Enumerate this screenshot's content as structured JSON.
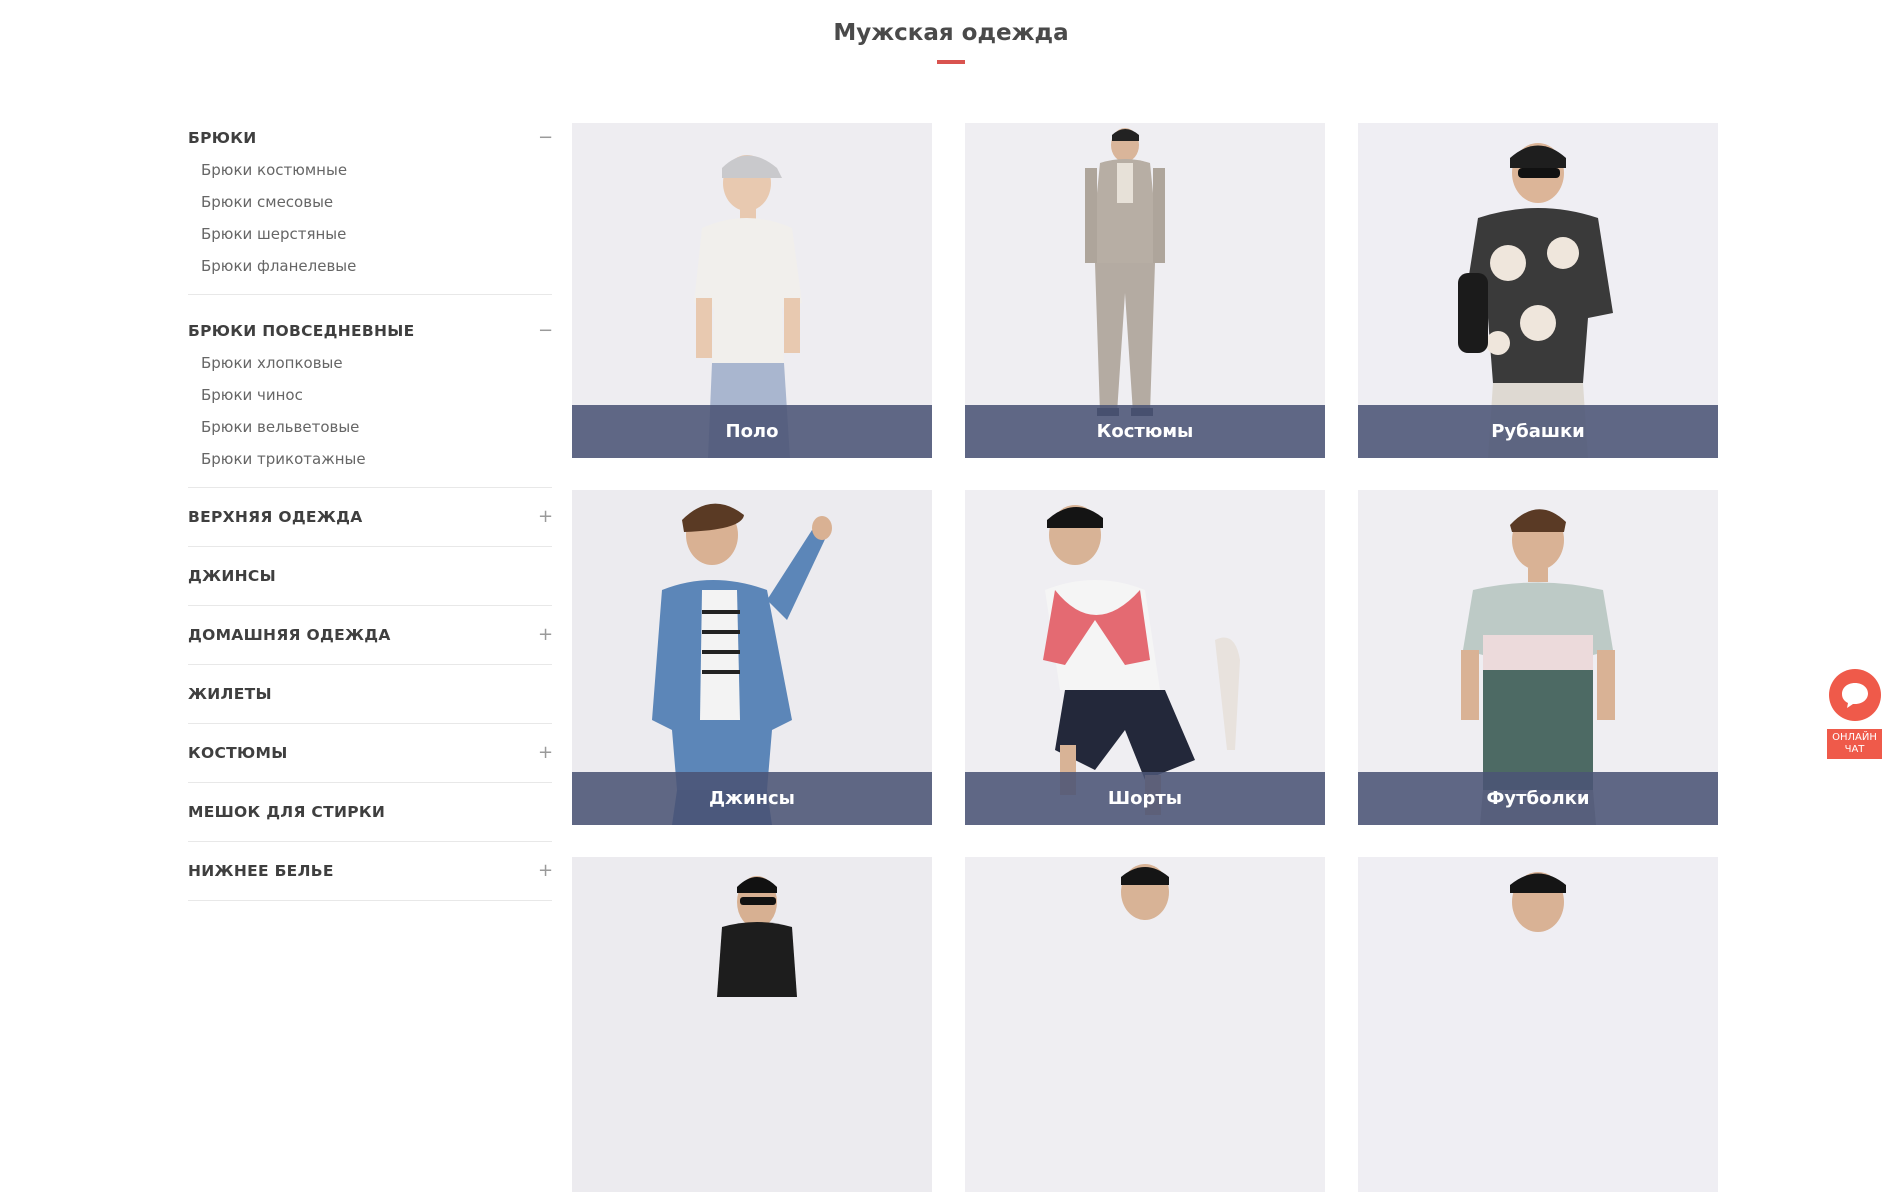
{
  "page": {
    "title": "Мужская одежда"
  },
  "colors": {
    "accent": "#d9534f",
    "caption_bg": "#4b5475",
    "chat": "#ef5a4a"
  },
  "sidebar": {
    "categories": [
      {
        "name": "БРЮКИ",
        "state": "expanded",
        "toggle": "−",
        "items": [
          "Брюки костюмные",
          "Брюки смесовые",
          "Брюки шерстяные",
          "Брюки фланелевые"
        ]
      },
      {
        "name": "БРЮКИ ПОВСЕДНЕВНЫЕ",
        "state": "expanded",
        "toggle": "−",
        "items": [
          "Брюки хлопковые",
          "Брюки чинос",
          "Брюки вельветовые",
          "Брюки трикотажные"
        ]
      },
      {
        "name": "ВЕРХНЯЯ ОДЕЖДА",
        "state": "collapsed",
        "toggle": "+"
      },
      {
        "name": "ДЖИНСЫ",
        "state": "collapsed",
        "toggle": ""
      },
      {
        "name": "ДОМАШНЯЯ ОДЕЖДА",
        "state": "collapsed",
        "toggle": "+"
      },
      {
        "name": "ЖИЛЕТЫ",
        "state": "collapsed",
        "toggle": ""
      },
      {
        "name": "КОСТЮМЫ",
        "state": "collapsed",
        "toggle": "+"
      },
      {
        "name": "МЕШОК ДЛЯ СТИРКИ",
        "state": "collapsed",
        "toggle": ""
      },
      {
        "name": "НИЖНЕЕ БЕЛЬЕ",
        "state": "collapsed",
        "toggle": "+"
      }
    ]
  },
  "grid": {
    "cards": [
      {
        "label": "Поло",
        "image": "model-polo"
      },
      {
        "label": "Костюмы",
        "image": "model-suit"
      },
      {
        "label": "Рубашки",
        "image": "model-shirt"
      },
      {
        "label": "Джинсы",
        "image": "model-denim"
      },
      {
        "label": "Шорты",
        "image": "model-shorts"
      },
      {
        "label": "Футболки",
        "image": "model-tshirt"
      },
      {
        "label": "",
        "image": "model-partial"
      },
      {
        "label": "",
        "image": "model-partial"
      },
      {
        "label": "",
        "image": "model-partial"
      }
    ]
  },
  "chat": {
    "icon": "chat-bubble-icon",
    "label_line1": "ОНЛАЙН",
    "label_line2": "ЧАТ"
  }
}
